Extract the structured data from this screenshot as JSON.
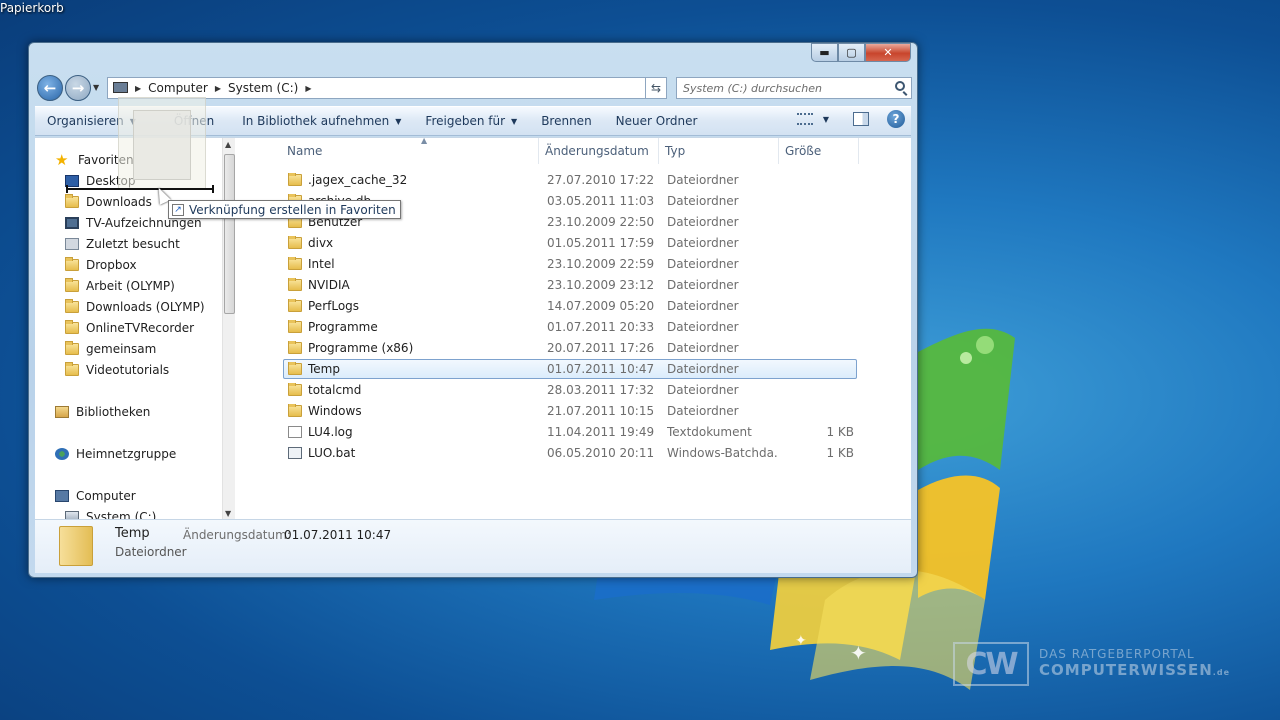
{
  "desktop": {
    "recycle_bin_label": "Papierkorb",
    "watermark": {
      "logo": "CW",
      "line1": "DAS RATGEBERPORTAL",
      "line2": "COMPUTERWISSEN",
      "suffix": ".de"
    }
  },
  "window": {
    "caption": {
      "minimize": "▬",
      "maximize": "▢",
      "close": "✕"
    },
    "address": {
      "crumbs": [
        "Computer",
        "System (C:)"
      ]
    },
    "search": {
      "placeholder": "System (C:) durchsuchen"
    },
    "toolbar": {
      "organize": "Organisieren",
      "open": "Öffnen",
      "include_library": "In Bibliothek aufnehmen",
      "share": "Freigeben für",
      "burn": "Brennen",
      "new_folder": "Neuer Ordner"
    },
    "nav": {
      "favorites": "Favoriten",
      "items": [
        {
          "label": "Desktop",
          "icon": "desktop-icon"
        },
        {
          "label": "Downloads",
          "icon": "folder-icon"
        },
        {
          "label": "TV-Aufzeichnungen",
          "icon": "tv-icon"
        },
        {
          "label": "Zuletzt besucht",
          "icon": "recent-icon"
        },
        {
          "label": "Dropbox",
          "icon": "folder-icon"
        },
        {
          "label": "Arbeit (OLYMP)",
          "icon": "folder-icon"
        },
        {
          "label": "Downloads (OLYMP)",
          "icon": "folder-icon"
        },
        {
          "label": "OnlineTVRecorder",
          "icon": "folder-icon"
        },
        {
          "label": "gemeinsam",
          "icon": "folder-icon"
        },
        {
          "label": "Videotutorials",
          "icon": "folder-icon"
        }
      ],
      "libraries": "Bibliotheken",
      "homegroup": "Heimnetzgruppe",
      "computer": "Computer",
      "drive": "System (C:)"
    },
    "columns": {
      "name": "Name",
      "date": "Änderungsdatum",
      "type": "Typ",
      "size": "Größe"
    },
    "files": [
      {
        "name": ".jagex_cache_32",
        "date": "27.07.2010 17:22",
        "type": "Dateiordner",
        "size": "",
        "icon": "folder-icon"
      },
      {
        "name": "archive.db",
        "date": "03.05.2011 11:03",
        "type": "Dateiordner",
        "size": "",
        "icon": "folder-icon"
      },
      {
        "name": "Benutzer",
        "date": "23.10.2009 22:50",
        "type": "Dateiordner",
        "size": "",
        "icon": "folder-icon"
      },
      {
        "name": "divx",
        "date": "01.05.2011 17:59",
        "type": "Dateiordner",
        "size": "",
        "icon": "folder-icon"
      },
      {
        "name": "Intel",
        "date": "23.10.2009 22:59",
        "type": "Dateiordner",
        "size": "",
        "icon": "folder-icon"
      },
      {
        "name": "NVIDIA",
        "date": "23.10.2009 23:12",
        "type": "Dateiordner",
        "size": "",
        "icon": "folder-icon"
      },
      {
        "name": "PerfLogs",
        "date": "14.07.2009 05:20",
        "type": "Dateiordner",
        "size": "",
        "icon": "folder-icon"
      },
      {
        "name": "Programme",
        "date": "01.07.2011 20:33",
        "type": "Dateiordner",
        "size": "",
        "icon": "folder-icon"
      },
      {
        "name": "Programme (x86)",
        "date": "20.07.2011 17:26",
        "type": "Dateiordner",
        "size": "",
        "icon": "folder-icon"
      },
      {
        "name": "Temp",
        "date": "01.07.2011 10:47",
        "type": "Dateiordner",
        "size": "",
        "icon": "folder-icon",
        "selected": true
      },
      {
        "name": "totalcmd",
        "date": "28.03.2011 17:32",
        "type": "Dateiordner",
        "size": "",
        "icon": "folder-icon"
      },
      {
        "name": "Windows",
        "date": "21.07.2011 10:15",
        "type": "Dateiordner",
        "size": "",
        "icon": "folder-icon"
      },
      {
        "name": "LU4.log",
        "date": "11.04.2011 19:49",
        "type": "Textdokument",
        "size": "1 KB",
        "icon": "text-document-icon"
      },
      {
        "name": "LUO.bat",
        "date": "06.05.2010 20:11",
        "type": "Windows-Batchda...",
        "size": "1 KB",
        "icon": "batch-file-icon"
      }
    ],
    "details": {
      "name": "Temp",
      "type": "Dateiordner",
      "date_label": "Änderungsdatum:",
      "date_value": "01.07.2011 10:47"
    },
    "tooltip": "Verknüpfung erstellen in Favoriten"
  }
}
